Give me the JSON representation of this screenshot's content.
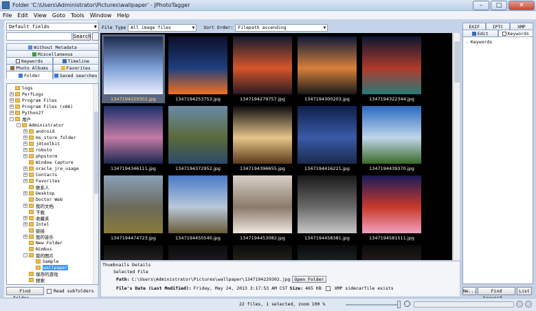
{
  "window": {
    "title": "Folder 'C:\\Users\\Administrator\\Pictures\\wallpaper' - JPhotoTagger",
    "min_label": "–",
    "max_label": "□",
    "close_label": "✕"
  },
  "menu": [
    "File",
    "Edit",
    "View",
    "Goto",
    "Tools",
    "Window",
    "Help"
  ],
  "left": {
    "field_select": "Default fields",
    "search_button": "Search",
    "tabs_row1": [
      "Without Metadata"
    ],
    "tabs_row2": [
      "Miscellaneous"
    ],
    "tabs_row3": [
      "Keywords",
      "Timeline"
    ],
    "tabs_row4": [
      "Photo Albums",
      "Favorites"
    ],
    "tabs_row5": [
      "Folder",
      "Saved searches"
    ],
    "tree": [
      {
        "label": "logs",
        "indent": 0,
        "exp": ""
      },
      {
        "label": "PerfLogs",
        "indent": 0,
        "exp": "+"
      },
      {
        "label": "Program Files",
        "indent": 0,
        "exp": "+"
      },
      {
        "label": "Program Files (x86)",
        "indent": 0,
        "exp": "+"
      },
      {
        "label": "Python27",
        "indent": 0,
        "exp": "+"
      },
      {
        "label": "用户",
        "indent": 0,
        "exp": "-"
      },
      {
        "label": "Administrator",
        "indent": 1,
        "exp": "-"
      },
      {
        "label": "android",
        "indent": 2,
        "exp": "+"
      },
      {
        "label": "ms_store_folder",
        "indent": 2,
        "exp": "+"
      },
      {
        "label": "jdtoolkit",
        "indent": 2,
        "exp": "+"
      },
      {
        "label": "roboto",
        "indent": 2,
        "exp": "+"
      },
      {
        "label": "phpstorm",
        "indent": 2,
        "exp": "+"
      },
      {
        "label": "Window Capture",
        "indent": 2,
        "exp": ""
      },
      {
        "label": "oracle_jre_usage",
        "indent": 2,
        "exp": "+"
      },
      {
        "label": "Contacts",
        "indent": 2,
        "exp": "+"
      },
      {
        "label": "Favorites",
        "indent": 2,
        "exp": "+"
      },
      {
        "label": "联系人",
        "indent": 2,
        "exp": ""
      },
      {
        "label": "Desktop",
        "indent": 2,
        "exp": "+"
      },
      {
        "label": "Doctor Web",
        "indent": 2,
        "exp": ""
      },
      {
        "label": "我的文档",
        "indent": 2,
        "exp": "+"
      },
      {
        "label": "下载",
        "indent": 2,
        "exp": ""
      },
      {
        "label": "收藏夹",
        "indent": 2,
        "exp": "+"
      },
      {
        "label": "Intel",
        "indent": 2,
        "exp": "+"
      },
      {
        "label": "链接",
        "indent": 2,
        "exp": ""
      },
      {
        "label": "我的音乐",
        "indent": 2,
        "exp": "+"
      },
      {
        "label": "New Folder",
        "indent": 2,
        "exp": ""
      },
      {
        "label": "Nimbus",
        "indent": 2,
        "exp": ""
      },
      {
        "label": "我的图片",
        "indent": 2,
        "exp": "-"
      },
      {
        "label": "Sample",
        "indent": 3,
        "exp": ""
      },
      {
        "label": "wallpaper",
        "indent": 3,
        "exp": "",
        "selected": true
      },
      {
        "label": "保存的游戏",
        "indent": 2,
        "exp": ""
      },
      {
        "label": "搜索",
        "indent": 2,
        "exp": ""
      }
    ],
    "find_folder": "Find folder...",
    "read_subfolders": "Read subfolders"
  },
  "toolbar": {
    "file_type_label": "File Type",
    "file_type_value": "All image files",
    "sort_label": "Sort Order:",
    "sort_value": "Filepath ascending"
  },
  "thumbnails": [
    {
      "name": "1347194229302.jpg",
      "selected": true,
      "c1": "#1b2b4d",
      "c2": "#7fa0d8",
      "c3": "#e8eef9"
    },
    {
      "name": "1347194253753.jpg",
      "c1": "#0b0f2b",
      "c2": "#1f3f7f",
      "c3": "#f07020"
    },
    {
      "name": "1347194279757.jpg",
      "c1": "#141a2f",
      "c2": "#d5562a",
      "c3": "#2a1a22"
    },
    {
      "name": "1347194300203.jpg",
      "c1": "#0e1a3a",
      "c2": "#d8803a",
      "c3": "#1a1a1a"
    },
    {
      "name": "1347194322344.jpg",
      "c1": "#0a1730",
      "c2": "#b03a2a",
      "c3": "#2a7a7a"
    },
    {
      "name": "1347194346111.jpg",
      "c1": "#1a2f6a",
      "c2": "#c47aa5",
      "c3": "#1c2850"
    },
    {
      "name": "1347194372952.jpg",
      "c1": "#6a8aa8",
      "c2": "#5a6a3a",
      "c3": "#2b4a6a"
    },
    {
      "name": "1347194396655.jpg",
      "c1": "#0c0c10",
      "c2": "#e6c58a",
      "c3": "#5a3a1a"
    },
    {
      "name": "1347194416221.jpg",
      "c1": "#0f1f4a",
      "c2": "#3a5aa8",
      "c3": "#1a2a4a"
    },
    {
      "name": "1347194439370.jpg",
      "c1": "#2a6ac0",
      "c2": "#bfd6ea",
      "c3": "#3a6a2a"
    },
    {
      "name": "1347194474723.jpg",
      "c1": "#8aa0b8",
      "c2": "#6a6a5a",
      "c3": "#8a7a3a"
    },
    {
      "name": "1347194450540.jpg",
      "c1": "#4a7ac8",
      "c2": "#b8c8d8",
      "c3": "#6a5a3a"
    },
    {
      "name": "1347194453082.jpg",
      "c1": "#d8d0c8",
      "c2": "#8a7a6a",
      "c3": "#f0e8e0"
    },
    {
      "name": "1347194458381.jpg",
      "c1": "#1a1a1a",
      "c2": "#6a6a6a",
      "c3": "#c8c8c8"
    },
    {
      "name": "1347194581511.jpg",
      "c1": "#1a1a5a",
      "c2": "#c83a2a",
      "c3": "#f0a0c0"
    },
    {
      "name": "",
      "c1": "#0a0a0a",
      "c2": "#3a3a3a",
      "c3": "#101010"
    },
    {
      "name": "",
      "c1": "#0a0a0a",
      "c2": "#2a2a3a",
      "c3": "#101010"
    },
    {
      "name": "",
      "c1": "#0a0a0a",
      "c2": "#3a3a2a",
      "c3": "#101010"
    },
    {
      "name": "",
      "c1": "#0a0a0a",
      "c2": "#2a3a3a",
      "c3": "#101010"
    },
    {
      "name": "",
      "c1": "#0a0a0a",
      "c2": "#3a2a2a",
      "c3": "#101010"
    }
  ],
  "details": {
    "header": "Thumbnails Details",
    "selected_file_label": "Selected File",
    "path_label": "Path:",
    "path_value": "C:\\Users\\Administrator\\Pictures\\wallpaper\\1347194229302.jpg",
    "open_folder": "Open Folder",
    "date_label": "File's Date (Last Modified):",
    "date_value": "Friday, May 24, 2013 3:17:53 AM CST",
    "size_label": "Size:",
    "size_value": "465 KB",
    "xmp_label": "XMP sidecarfile exists"
  },
  "right": {
    "tabs_row1": [
      "EXIF",
      "IPTC",
      "XMP"
    ],
    "tabs_row2": [
      "Edit",
      "Keywords"
    ],
    "keywords_root": "Keywords",
    "btn_new": "Ne...",
    "btn_find": "Find keyword...",
    "btn_list": "List"
  },
  "status": {
    "text": "22 files, 1 selected, zoom 100 %"
  }
}
